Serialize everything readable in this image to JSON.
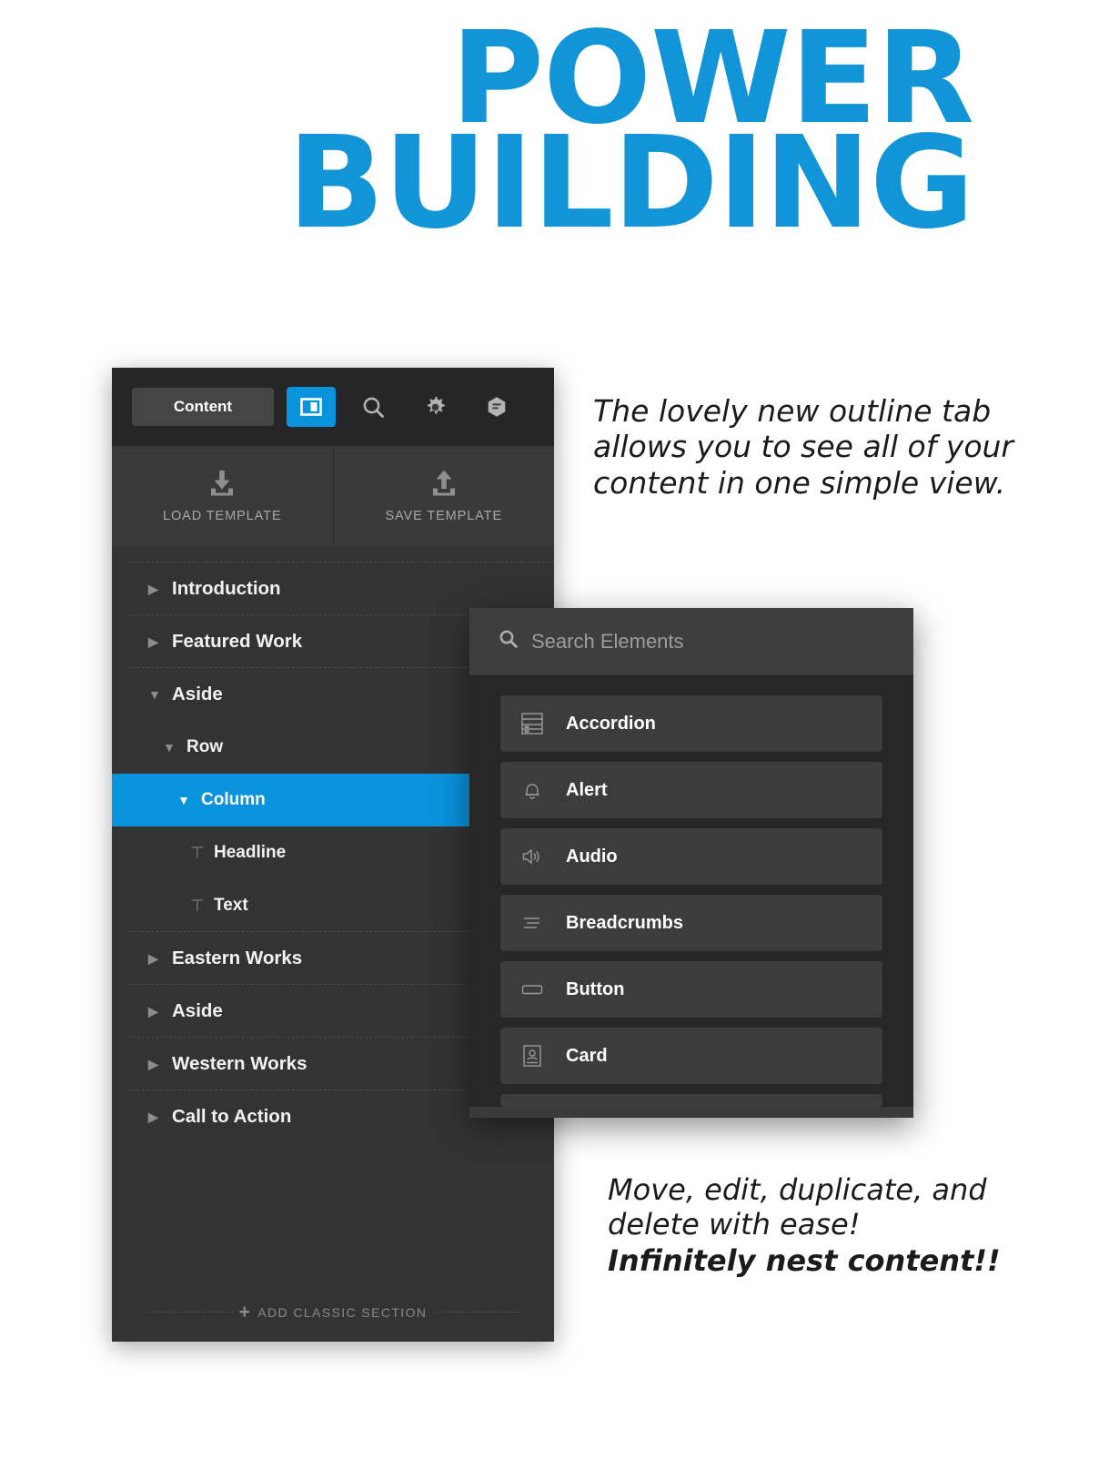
{
  "hero": {
    "line1": "POWER",
    "line2": "BUILDING",
    "color": "#1295d8"
  },
  "accent_color": "#0a93dd",
  "outline_panel": {
    "toolbar": {
      "content_tab_label": "Content",
      "icons": [
        {
          "name": "outline-panel-icon",
          "active": true
        },
        {
          "name": "search-icon",
          "active": false
        },
        {
          "name": "gear-icon",
          "active": false
        },
        {
          "name": "hexagon-lines-icon",
          "active": false
        }
      ]
    },
    "template_buttons": [
      {
        "label": "LOAD TEMPLATE",
        "icon": "download-icon"
      },
      {
        "label": "SAVE TEMPLATE",
        "icon": "upload-icon"
      }
    ],
    "tree": [
      {
        "label": "Introduction",
        "level": 1,
        "twisty": "collapsed",
        "selected": false,
        "separator": true,
        "glyph": ""
      },
      {
        "label": "Featured Work",
        "level": 1,
        "twisty": "collapsed",
        "selected": false,
        "separator": true,
        "glyph": ""
      },
      {
        "label": "Aside",
        "level": 1,
        "twisty": "expanded",
        "selected": false,
        "separator": true,
        "glyph": ""
      },
      {
        "label": "Row",
        "level": 2,
        "twisty": "expanded",
        "selected": false,
        "separator": false,
        "glyph": ""
      },
      {
        "label": "Column",
        "level": 3,
        "twisty": "expanded",
        "selected": true,
        "separator": false,
        "glyph": ""
      },
      {
        "label": "Headline",
        "level": 4,
        "twisty": "none",
        "selected": false,
        "separator": false,
        "glyph": "text-icon"
      },
      {
        "label": "Text",
        "level": 4,
        "twisty": "none",
        "selected": false,
        "separator": false,
        "glyph": "text-icon"
      },
      {
        "label": "Eastern Works",
        "level": 1,
        "twisty": "collapsed",
        "selected": false,
        "separator": true,
        "glyph": ""
      },
      {
        "label": "Aside",
        "level": 1,
        "twisty": "collapsed",
        "selected": false,
        "separator": true,
        "glyph": ""
      },
      {
        "label": "Western Works",
        "level": 1,
        "twisty": "collapsed",
        "selected": false,
        "separator": true,
        "glyph": ""
      },
      {
        "label": "Call to Action",
        "level": 1,
        "twisty": "collapsed",
        "selected": false,
        "separator": true,
        "glyph": ""
      }
    ],
    "selected_row_actions": [
      "search-icon",
      "plus-icon"
    ],
    "footer": {
      "add_classic_label": "ADD CLASSIC SECTION",
      "plus": "+"
    }
  },
  "elements_panel": {
    "search_placeholder": "Search Elements",
    "search_value": "",
    "items": [
      {
        "label": "Accordion",
        "icon": "accordion-icon"
      },
      {
        "label": "Alert",
        "icon": "bell-icon"
      },
      {
        "label": "Audio",
        "icon": "speaker-icon"
      },
      {
        "label": "Breadcrumbs",
        "icon": "breadcrumbs-icon"
      },
      {
        "label": "Button",
        "icon": "button-icon"
      },
      {
        "label": "Card",
        "icon": "card-icon"
      }
    ]
  },
  "captions": {
    "top": "The lovely new outline tab allows you to see all of your content in one simple view.",
    "bottom_regular": "Move, edit, duplicate, and delete with ease!",
    "bottom_bold": "Infinitely nest content!!"
  }
}
